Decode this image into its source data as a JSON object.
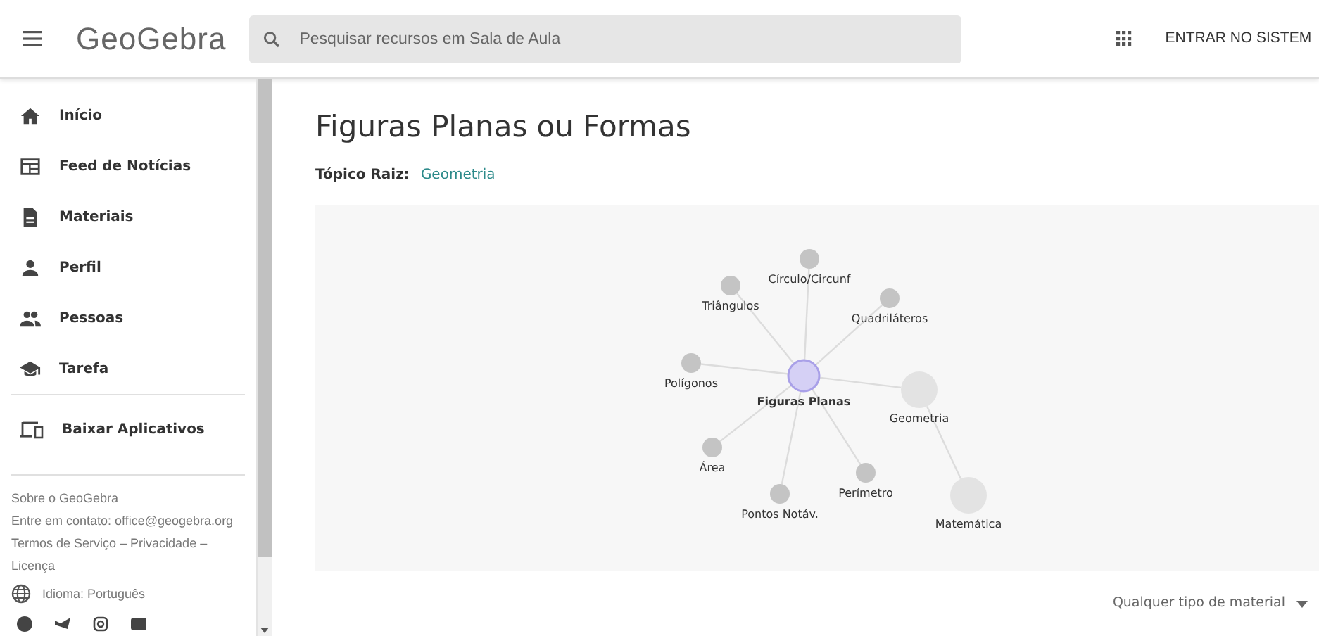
{
  "header": {
    "logo": "GeoGebra",
    "search": {
      "placeholder": "Pesquisar recursos em Sala de Aula"
    },
    "login": "ENTRAR NO SISTEM"
  },
  "sidebar": {
    "items": [
      {
        "label": "Início",
        "kind": "home"
      },
      {
        "label": "Feed de Notícias",
        "kind": "feed"
      },
      {
        "label": "Materiais",
        "kind": "doc"
      },
      {
        "label": "Perfil",
        "kind": "person"
      },
      {
        "label": "Pessoas",
        "kind": "people"
      },
      {
        "label": "Tarefa",
        "kind": "school"
      }
    ],
    "apps": {
      "label": "Baixar Aplicativos"
    },
    "footer": {
      "about": "Sobre o GeoGebra",
      "contact": "Entre em contato: office@geogebra.org",
      "terms": "Termos de Serviço",
      "sep1": "–",
      "privacy": "Privacidade",
      "sep2": "–",
      "license": "Licença",
      "language": "Idioma: Português"
    }
  },
  "page": {
    "title": "Figuras Planas ou Formas",
    "root_label": "Tópico Raiz:",
    "root_link": "Geometria",
    "graph": {
      "label": "Matemática",
      "kind": "parent",
      "children": [
        {
          "label": "Geometria",
          "kind": "parent",
          "children": [
            {
              "label": "Figuras Planas",
              "kind": "current",
              "children": [
                {
                  "label": "Círculo/Circunf",
                  "kind": "topic"
                },
                {
                  "label": "Triângulos",
                  "kind": "topic"
                },
                {
                  "label": "Quadriláteros",
                  "kind": "topic"
                },
                {
                  "label": "Polígonos",
                  "kind": "topic"
                },
                {
                  "label": "Área",
                  "kind": "topic"
                },
                {
                  "label": "Pontos Notáv.",
                  "kind": "topic"
                },
                {
                  "label": "Perímetro",
                  "kind": "topic"
                }
              ]
            }
          ]
        }
      ]
    },
    "filter": "Qualquer tipo de material"
  }
}
